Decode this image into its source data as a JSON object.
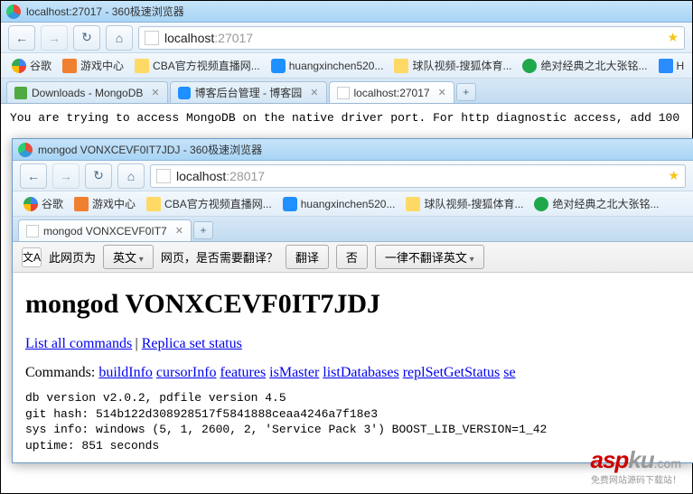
{
  "outer": {
    "title": "localhost:27017 - 360极速浏览器",
    "url_main": "localhost",
    "url_port": ":27017",
    "bookmarks": [
      {
        "icon": "ico-google",
        "label": "谷歌"
      },
      {
        "icon": "ico-game",
        "label": "游戏中心"
      },
      {
        "icon": "ico-hand",
        "label": "CBA官方视频直播网..."
      },
      {
        "icon": "ico-blue",
        "label": "huangxinchen520..."
      },
      {
        "icon": "ico-hand",
        "label": "球队视频-搜狐体育..."
      },
      {
        "icon": "ico-play",
        "label": "绝对经典之北大张铭..."
      },
      {
        "icon": "ico-sq",
        "label": "H"
      }
    ],
    "tabs": [
      {
        "icon": "ico-mongo",
        "label": "Downloads - MongoDB",
        "active": false
      },
      {
        "icon": "ico-blue",
        "label": "博客后台管理 - 博客园",
        "active": false
      },
      {
        "icon": "ico-page",
        "label": "localhost:27017",
        "active": true
      }
    ],
    "body_text": "You are trying to access MongoDB on the native driver port. For http diagnostic access, add 100"
  },
  "inner": {
    "title": "mongod VONXCEVF0IT7JDJ - 360极速浏览器",
    "url_main": "localhost",
    "url_port": ":28017",
    "bookmarks": [
      {
        "icon": "ico-google",
        "label": "谷歌"
      },
      {
        "icon": "ico-game",
        "label": "游戏中心"
      },
      {
        "icon": "ico-hand",
        "label": "CBA官方视频直播网..."
      },
      {
        "icon": "ico-blue",
        "label": "huangxinchen520..."
      },
      {
        "icon": "ico-hand",
        "label": "球队视频-搜狐体育..."
      },
      {
        "icon": "ico-play",
        "label": "绝对经典之北大张铭..."
      }
    ],
    "tab_label": "mongod VONXCEVF0IT7"
  },
  "translate": {
    "icon_text": "文A",
    "prefix": "此网页为",
    "lang": "英文",
    "suffix": "网页，是否需要翻译？",
    "btn_translate": "翻译",
    "btn_no": "否",
    "btn_never": "一律不翻译英文"
  },
  "page": {
    "h1": "mongod VONXCEVF0IT7JDJ",
    "link_list_all": "List all commands",
    "sep1": " | ",
    "link_replica": "Replica set status",
    "commands_label": "Commands: ",
    "commands": [
      {
        "text": "buildInfo"
      },
      {
        "text": "cursorInfo"
      },
      {
        "text": "features"
      },
      {
        "text": "isMaster"
      },
      {
        "text": "listDatabases"
      },
      {
        "text": "replSetGetStatus"
      },
      {
        "text": "se"
      }
    ],
    "info_lines": [
      "db version v2.0.2, pdfile version 4.5",
      "git hash: 514b122d308928517f5841888ceaa4246a7f18e3",
      "sys info: windows (5, 1, 2600, 2, 'Service Pack 3') BOOST_LIB_VERSION=1_42",
      "uptime: 851 seconds"
    ]
  },
  "watermark": {
    "red": "asp",
    "gray": "ku",
    "com": ".com",
    "sub": "免费网站源码下载站！"
  }
}
